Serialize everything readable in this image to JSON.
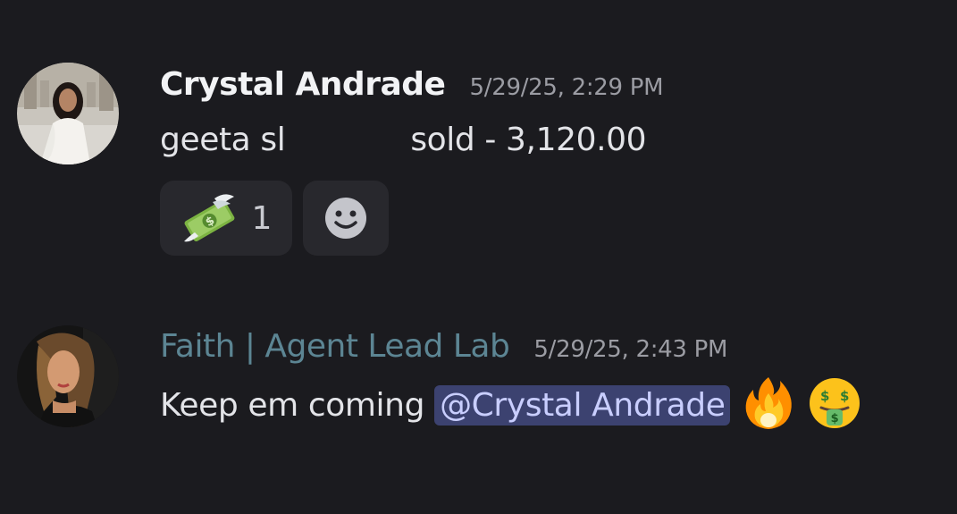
{
  "messages": [
    {
      "author": "Crystal Andrade",
      "author_color": "#f2f3f5",
      "timestamp": "5/29/25, 2:29 PM",
      "content_prefix": "geeta sl",
      "content_suffix": "sold - 3,120.00",
      "reactions": [
        {
          "emoji": "money-with-wings-icon",
          "count": "1"
        }
      ],
      "add_reaction_icon": "add-reaction-smiley-icon"
    },
    {
      "author": "Faith | Agent Lead Lab",
      "author_color": "#5c8593",
      "timestamp": "5/29/25, 2:43 PM",
      "content_text": "Keep em coming ",
      "mention": "@Crystal Andrade",
      "emojis": [
        "fire-icon",
        "money-mouth-face-icon"
      ]
    }
  ],
  "colors": {
    "background": "#1b1b1f",
    "mention_bg": "#3c4270",
    "mention_text": "#c9ceff",
    "timestamp": "#9b9ca3"
  }
}
